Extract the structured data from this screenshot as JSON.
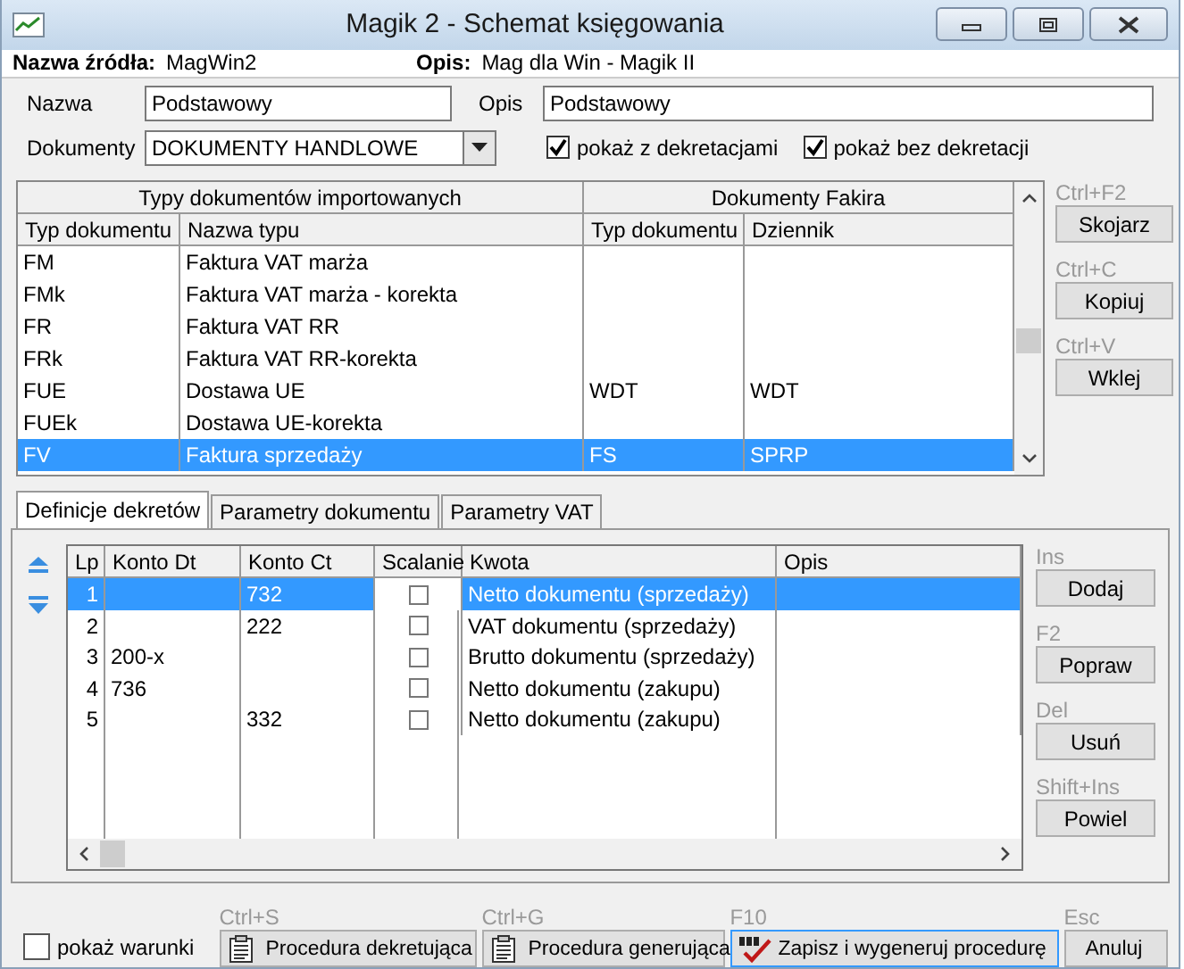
{
  "window": {
    "title": "Magik 2 - Schemat księgowania"
  },
  "source": {
    "name_label": "Nazwa źródła:",
    "name_value": "MagWin2",
    "desc_label": "Opis:",
    "desc_value": "Mag dla Win - Magik II"
  },
  "form": {
    "name_label": "Nazwa",
    "name_value": "Podstawowy",
    "desc_label": "Opis",
    "desc_value": "Podstawowy",
    "documents_label": "Dokumenty",
    "documents_value": "DOKUMENTY HANDLOWE",
    "checkboxes": [
      {
        "label": "pokaż z dekretacjami",
        "checked": true
      },
      {
        "label": "pokaż bez dekretacji",
        "checked": true
      }
    ]
  },
  "documents_table": {
    "groups": [
      "Typy dokumentów importowanych",
      "Dokumenty Fakira"
    ],
    "columns": [
      "Typ dokumentu",
      "Nazwa typu",
      "Typ dokumentu",
      "Dziennik"
    ],
    "rows": [
      {
        "cells": [
          "FM",
          "Faktura VAT marża",
          "",
          ""
        ],
        "selected": false
      },
      {
        "cells": [
          "FMk",
          "Faktura VAT marża - korekta",
          "",
          ""
        ],
        "selected": false
      },
      {
        "cells": [
          "FR",
          "Faktura VAT RR",
          "",
          ""
        ],
        "selected": false
      },
      {
        "cells": [
          "FRk",
          "Faktura VAT RR-korekta",
          "",
          ""
        ],
        "selected": false
      },
      {
        "cells": [
          "FUE",
          "Dostawa UE",
          "WDT",
          "WDT"
        ],
        "selected": false
      },
      {
        "cells": [
          "FUEk",
          "Dostawa UE-korekta",
          "",
          ""
        ],
        "selected": false
      },
      {
        "cells": [
          "FV",
          "Faktura sprzedaży",
          "FS",
          "SPRP"
        ],
        "selected": true
      }
    ]
  },
  "documents_actions": [
    {
      "shortcut": "Ctrl+F2",
      "label": "Skojarz"
    },
    {
      "shortcut": "Ctrl+C",
      "label": "Kopiuj"
    },
    {
      "shortcut": "Ctrl+V",
      "label": "Wklej"
    }
  ],
  "tabs": [
    {
      "label": "Definicje dekretów",
      "selected": true
    },
    {
      "label": "Parametry dokumentu",
      "selected": false
    },
    {
      "label": "Parametry VAT",
      "selected": false
    }
  ],
  "entries_table": {
    "columns": [
      "Lp",
      "Konto Dt",
      "Konto Ct",
      "Scalanie",
      "Kwota",
      "Opis"
    ],
    "rows": [
      {
        "lp": "1",
        "konto_dt": "",
        "konto_ct": "732",
        "merge": false,
        "amount": "Netto dokumentu (sprzedaży)",
        "selected": true
      },
      {
        "lp": "2",
        "konto_dt": "",
        "konto_ct": "222",
        "merge": false,
        "amount": "VAT dokumentu (sprzedaży)",
        "selected": false
      },
      {
        "lp": "3",
        "konto_dt": "200-x",
        "konto_ct": "",
        "merge": false,
        "amount": "Brutto dokumentu (sprzedaży)",
        "selected": false
      },
      {
        "lp": "4",
        "konto_dt": "736",
        "konto_ct": "",
        "merge": false,
        "amount": "Netto dokumentu (zakupu)",
        "selected": false
      },
      {
        "lp": "5",
        "konto_dt": "",
        "konto_ct": "332",
        "merge": false,
        "amount": "Netto dokumentu (zakupu)",
        "selected": false
      }
    ]
  },
  "entries_actions": [
    {
      "shortcut": "Ins",
      "label": "Dodaj"
    },
    {
      "shortcut": "F2",
      "label": "Popraw"
    },
    {
      "shortcut": "Del",
      "label": "Usuń"
    },
    {
      "shortcut": "Shift+Ins",
      "label": "Powiel"
    }
  ],
  "footer": {
    "checkbox": {
      "label": "pokaż warunki",
      "checked": false
    },
    "buttons": [
      {
        "shortcut": "Ctrl+S",
        "label": "Procedura dekretująca",
        "kind": "clipboard"
      },
      {
        "shortcut": "Ctrl+G",
        "label": "Procedura generująca",
        "kind": "clipboard"
      },
      {
        "shortcut": "F10",
        "label": "Zapisz i wygeneruj procedurę",
        "kind": "sql"
      },
      {
        "shortcut": "Esc",
        "label": "Anuluj",
        "kind": "plain"
      }
    ]
  }
}
